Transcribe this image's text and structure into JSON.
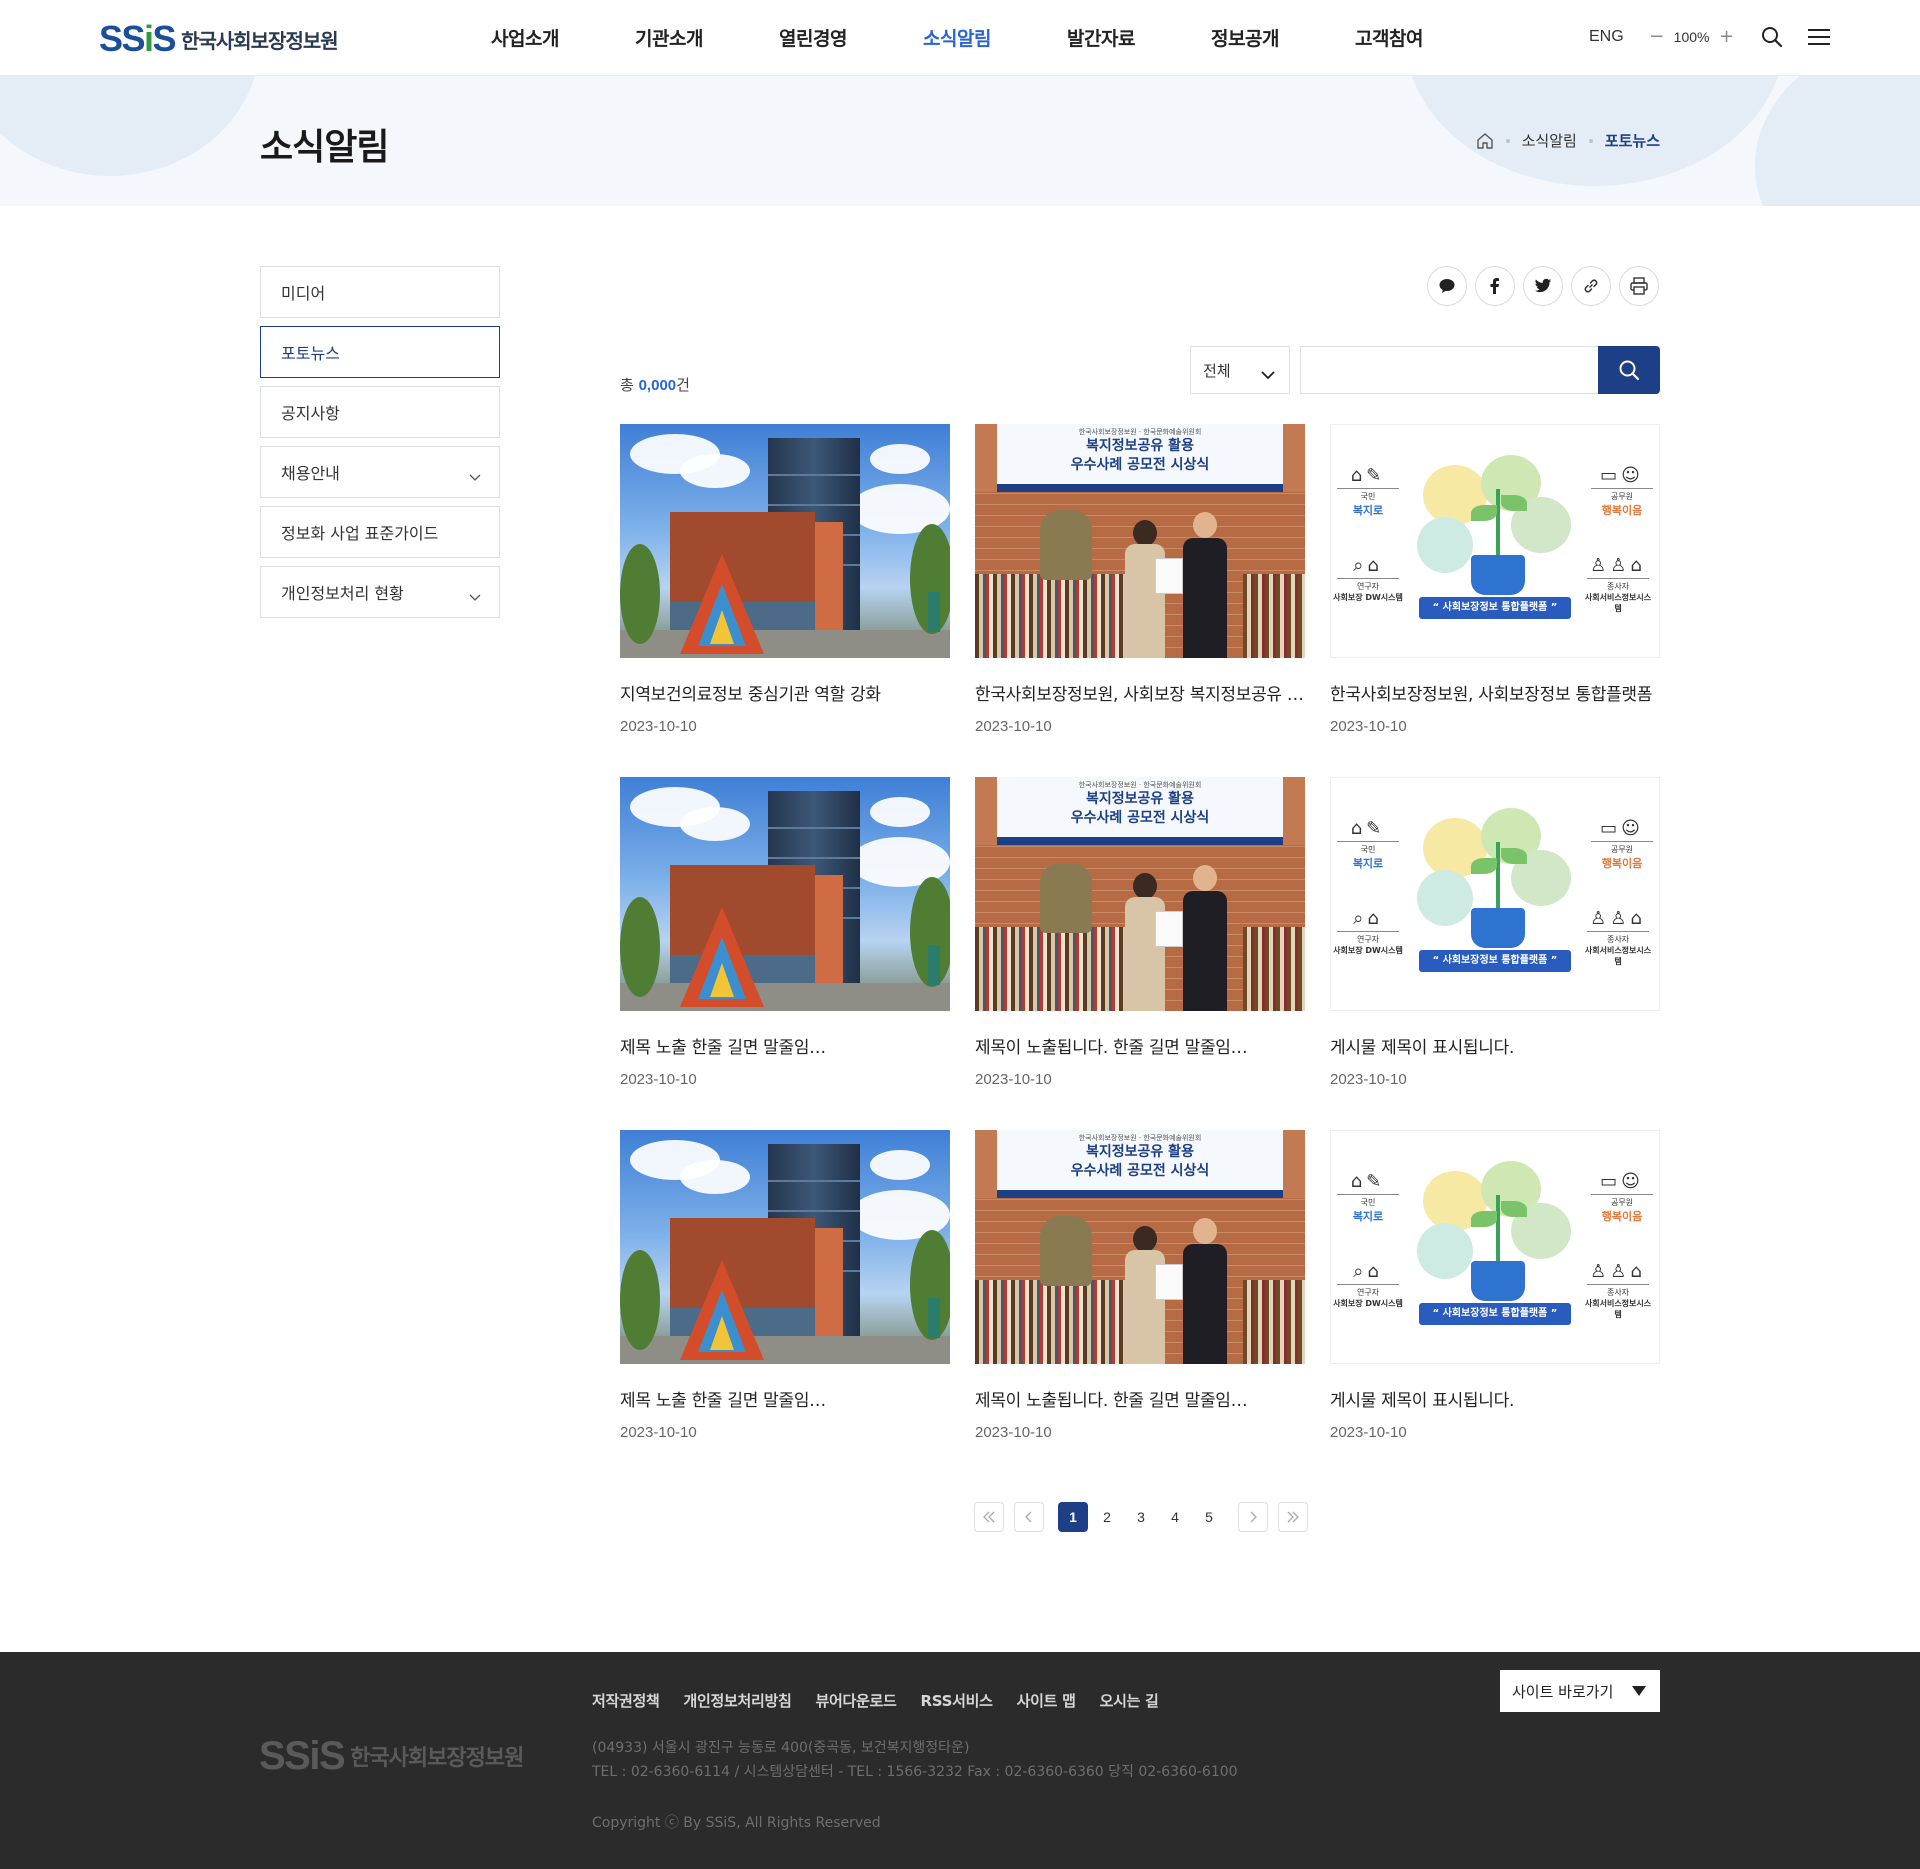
{
  "header": {
    "logo_mark": "SSiS",
    "logo_text": "한국사회보장정보원",
    "nav": [
      "사업소개",
      "기관소개",
      "열린경영",
      "소식알림",
      "발간자료",
      "정보공개",
      "고객참여"
    ],
    "nav_active_index": 3,
    "lang": "ENG",
    "zoom": "100%"
  },
  "subvisual": {
    "title": "소식알림",
    "breadcrumb": [
      "소식알림",
      "포토뉴스"
    ]
  },
  "lnb": {
    "items": [
      {
        "label": "미디어",
        "active": false,
        "has_sub": false
      },
      {
        "label": "포토뉴스",
        "active": true,
        "has_sub": false
      },
      {
        "label": "공지사항",
        "active": false,
        "has_sub": false
      },
      {
        "label": "채용안내",
        "active": false,
        "has_sub": true
      },
      {
        "label": "정보화 사업 표준가이드",
        "active": false,
        "has_sub": false
      },
      {
        "label": "개인정보처리 현황",
        "active": false,
        "has_sub": true
      }
    ]
  },
  "share_icons": [
    "chat-icon",
    "facebook-icon",
    "twitter-icon",
    "link-icon",
    "print-icon"
  ],
  "board": {
    "total_prefix": "총",
    "total_count": "0,000",
    "total_suffix": "건",
    "search_select": "전체",
    "search_value": "",
    "cards": [
      {
        "thumb": "building",
        "title": "지역보건의료정보 중심기관 역할 강화",
        "date": "2023-10-10"
      },
      {
        "thumb": "ceremony",
        "title": "한국사회보장정보원, 사회보장 복지정보공유 활용 우수사례 공모전 시상식",
        "date": "2023-10-10"
      },
      {
        "thumb": "infographic",
        "title": "한국사회보장정보원, 사회보장정보 통합플랫폼",
        "date": "2023-10-10"
      },
      {
        "thumb": "building",
        "title": "제목 노출 한줄 길면 말줄임…",
        "date": "2023-10-10"
      },
      {
        "thumb": "ceremony",
        "title": "제목이 노출됩니다. 한줄 길면 말줄임…",
        "date": "2023-10-10"
      },
      {
        "thumb": "infographic",
        "title": "게시물 제목이 표시됩니다.",
        "date": "2023-10-10"
      },
      {
        "thumb": "building",
        "title": "제목 노출 한줄 길면 말줄임…",
        "date": "2023-10-10"
      },
      {
        "thumb": "ceremony",
        "title": "제목이 노출됩니다. 한줄 길면 말줄임…",
        "date": "2023-10-10"
      },
      {
        "thumb": "infographic",
        "title": "게시물 제목이 표시됩니다.",
        "date": "2023-10-10"
      }
    ],
    "ceremony_banner": {
      "line0": "한국사회보장정보원 · 한국문화예술위원회",
      "line1": "복지정보공유 활용",
      "line2": "우수사례 공모전 시상식"
    },
    "infographic": {
      "left_top_label": "국민",
      "left_top_key": "복지로",
      "left_bottom_label": "연구자",
      "left_bottom_key": "사회보장 DW시스템",
      "right_top_label": "공무원",
      "right_top_key": "행복이음",
      "right_bottom_label": "종사자",
      "right_bottom_key": "사회서비스정보시스템",
      "pill": "“ 사회보장정보 통합플랫폼 ”"
    }
  },
  "pagination": {
    "pages": [
      "1",
      "2",
      "3",
      "4",
      "5"
    ],
    "current": "1"
  },
  "footer": {
    "links": [
      "저작권정책",
      "개인정보처리방침",
      "뷰어다운로드",
      "RSS서비스",
      "사이트 맵",
      "오시는 길"
    ],
    "site_select": "사이트 바로가기",
    "address": "(04933) 서울시 광진구 능동로 400(중곡동, 보건복지행정타운)",
    "contact": "TEL : 02-6360-6114 / 시스템상담센터 - TEL : 1566-3232  Fax : 02-6360-6360  당직 02-6360-6100",
    "copyright": "Copyright ⓒ By SSiS, All Rights Reserved"
  },
  "colors": {
    "primary": "#1c3f85",
    "nav_active": "#2a63d4",
    "footer_bg": "#2b2b2b",
    "subvisual_bg": "#f4f7fb"
  }
}
